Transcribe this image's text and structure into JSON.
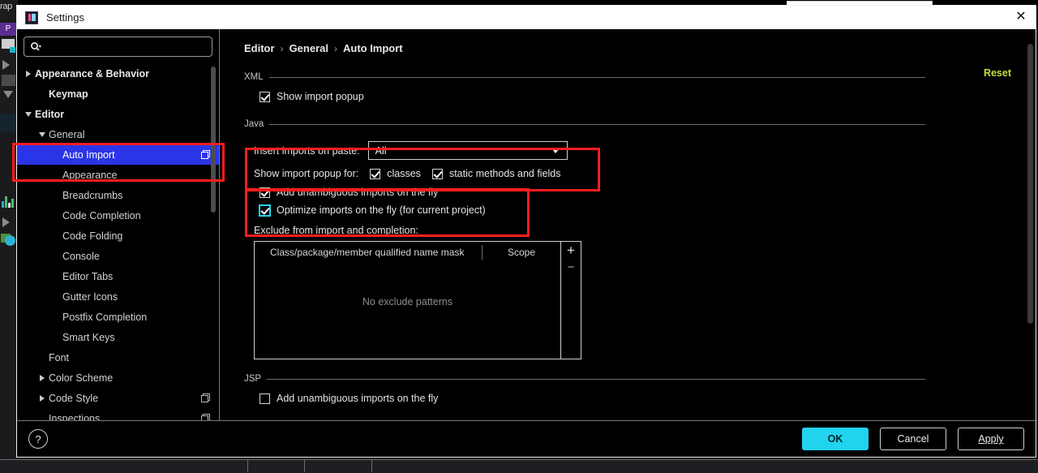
{
  "backdrop": {
    "top_left_text": "rap",
    "project_chip": "P"
  },
  "window": {
    "title": "Settings",
    "app_icon": "intellij-icon",
    "close_icon": "close-icon"
  },
  "sidebar": {
    "search": {
      "placeholder": "",
      "value": "",
      "icon": "search-icon"
    },
    "items": [
      {
        "label": "Appearance & Behavior",
        "indent": 0,
        "twisty": "right",
        "bold": true,
        "selected": false,
        "doc_icon": false
      },
      {
        "label": "Keymap",
        "indent": 1,
        "twisty": "none",
        "bold": true,
        "selected": false,
        "doc_icon": false
      },
      {
        "label": "Editor",
        "indent": 0,
        "twisty": "down",
        "bold": true,
        "selected": false,
        "doc_icon": false
      },
      {
        "label": "General",
        "indent": 1,
        "twisty": "down",
        "bold": false,
        "selected": false,
        "doc_icon": false
      },
      {
        "label": "Auto Import",
        "indent": 2,
        "twisty": "none",
        "bold": false,
        "selected": true,
        "doc_icon": true
      },
      {
        "label": "Appearance",
        "indent": 2,
        "twisty": "none",
        "bold": false,
        "selected": false,
        "doc_icon": false
      },
      {
        "label": "Breadcrumbs",
        "indent": 2,
        "twisty": "none",
        "bold": false,
        "selected": false,
        "doc_icon": false
      },
      {
        "label": "Code Completion",
        "indent": 2,
        "twisty": "none",
        "bold": false,
        "selected": false,
        "doc_icon": false
      },
      {
        "label": "Code Folding",
        "indent": 2,
        "twisty": "none",
        "bold": false,
        "selected": false,
        "doc_icon": false
      },
      {
        "label": "Console",
        "indent": 2,
        "twisty": "none",
        "bold": false,
        "selected": false,
        "doc_icon": false
      },
      {
        "label": "Editor Tabs",
        "indent": 2,
        "twisty": "none",
        "bold": false,
        "selected": false,
        "doc_icon": false
      },
      {
        "label": "Gutter Icons",
        "indent": 2,
        "twisty": "none",
        "bold": false,
        "selected": false,
        "doc_icon": false
      },
      {
        "label": "Postfix Completion",
        "indent": 2,
        "twisty": "none",
        "bold": false,
        "selected": false,
        "doc_icon": false
      },
      {
        "label": "Smart Keys",
        "indent": 2,
        "twisty": "none",
        "bold": false,
        "selected": false,
        "doc_icon": false
      },
      {
        "label": "Font",
        "indent": 1,
        "twisty": "none",
        "bold": false,
        "selected": false,
        "doc_icon": false
      },
      {
        "label": "Color Scheme",
        "indent": 1,
        "twisty": "right",
        "bold": false,
        "selected": false,
        "doc_icon": false
      },
      {
        "label": "Code Style",
        "indent": 1,
        "twisty": "right",
        "bold": false,
        "selected": false,
        "doc_icon": true
      },
      {
        "label": "Inspections",
        "indent": 1,
        "twisty": "none",
        "bold": false,
        "selected": false,
        "doc_icon": true
      }
    ]
  },
  "content": {
    "breadcrumb": [
      "Editor",
      "General",
      "Auto Import"
    ],
    "breadcrumb_separator": "›",
    "reset_label": "Reset",
    "sections": {
      "xml": {
        "title": "XML",
        "show_import_popup": {
          "label": "Show import popup",
          "checked": true
        }
      },
      "java": {
        "title": "Java",
        "insert_imports_label": "Insert imports on paste:",
        "insert_imports_value": "All",
        "show_import_popup_for_label": "Show import popup for:",
        "popup_for_classes": {
          "label": "classes",
          "checked": true
        },
        "popup_for_static": {
          "label": "static methods and fields",
          "checked": true
        },
        "add_unambiguous": {
          "label": "Add unambiguous imports on the fly",
          "checked": true
        },
        "optimize_imports": {
          "label": "Optimize imports on the fly (for current project)",
          "checked": true,
          "focused": true
        },
        "exclude_label": "Exclude from import and completion:",
        "table": {
          "columns": [
            "Class/package/member qualified name mask",
            "Scope"
          ],
          "rows": [],
          "empty_text": "No exclude patterns",
          "add_button": "+",
          "remove_button": "−"
        }
      },
      "jsp": {
        "title": "JSP",
        "add_unambiguous": {
          "label": "Add unambiguous imports on the fly",
          "checked": false
        }
      }
    }
  },
  "footer": {
    "help_label": "?",
    "ok_label": "OK",
    "cancel_label": "Cancel",
    "apply_label": "Apply"
  },
  "colors": {
    "selection_blue": "#2b35e8",
    "annotation_red": "#ff1d1d",
    "accent_cyan": "#22d3ee",
    "reset_yellow_green": "#c9dc3c"
  }
}
